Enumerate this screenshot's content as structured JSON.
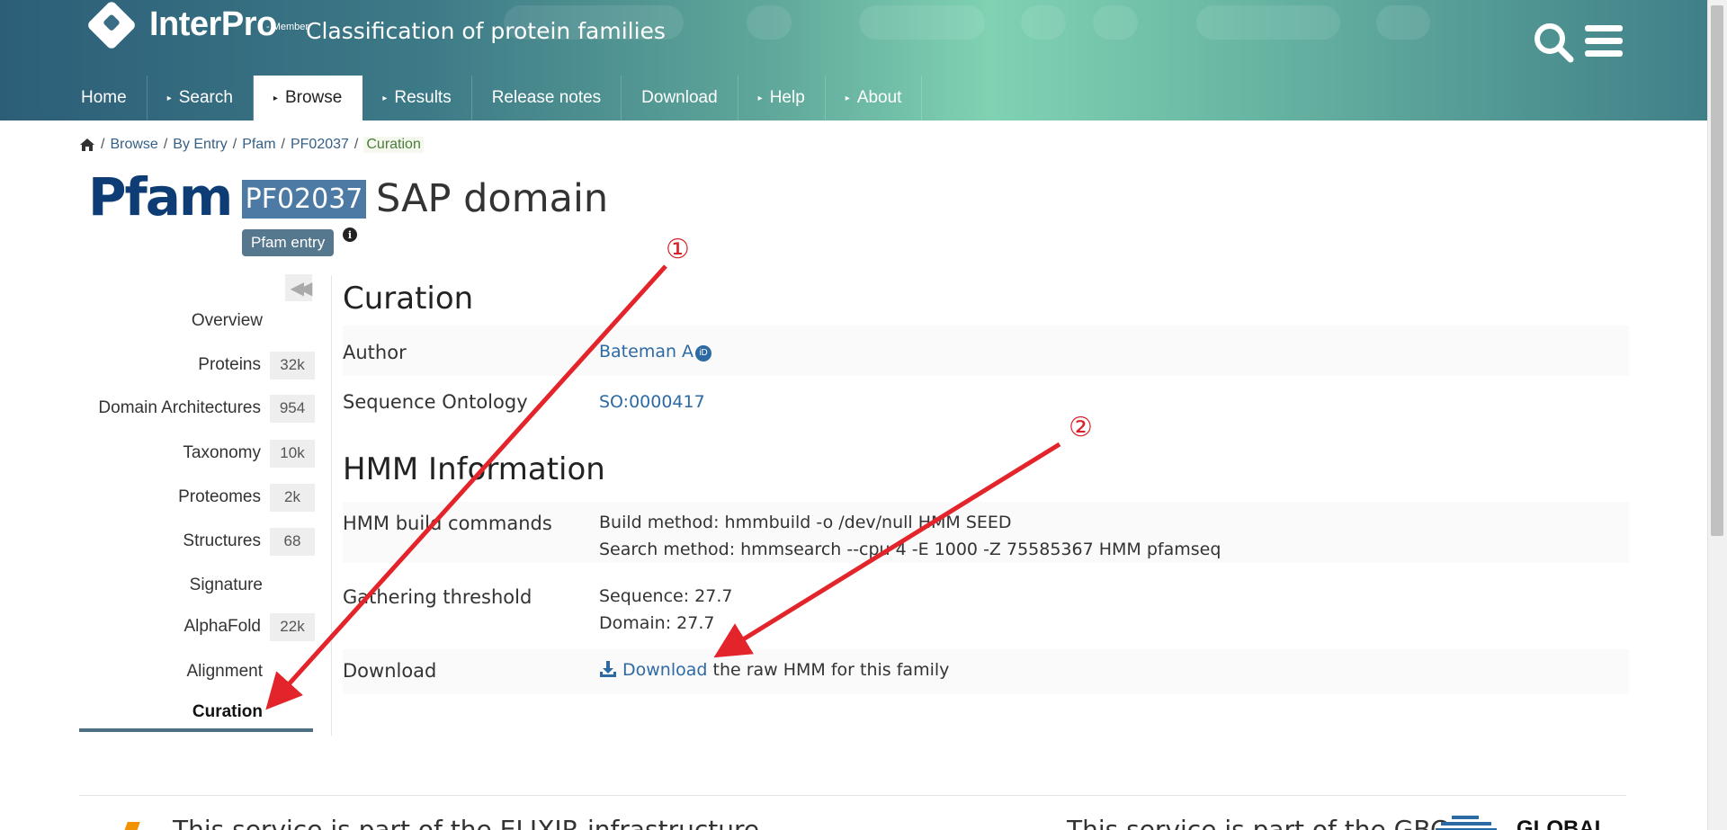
{
  "header": {
    "brand": "InterPro",
    "brand_sup": "- Member",
    "subtitle": "Classification of protein families",
    "icons": {
      "search": "search-icon",
      "menu": "hamburger-menu-icon",
      "logo": "interpro-logo"
    }
  },
  "nav": {
    "items": [
      {
        "label": "Home",
        "has_arrow": false
      },
      {
        "label": "Search",
        "has_arrow": true
      },
      {
        "label": "Browse",
        "has_arrow": true,
        "active": true
      },
      {
        "label": "Results",
        "has_arrow": true
      },
      {
        "label": "Release notes",
        "has_arrow": false
      },
      {
        "label": "Download",
        "has_arrow": false
      },
      {
        "label": "Help",
        "has_arrow": true
      },
      {
        "label": "About",
        "has_arrow": true
      }
    ],
    "arrow_glyph": "▸"
  },
  "breadcrumb": {
    "items": [
      "Browse",
      "By Entry",
      "Pfam",
      "PF02037"
    ],
    "current": "Curation",
    "separator": "/"
  },
  "entry": {
    "db_logo": "Pfam",
    "accession": "PF02037",
    "name": "SAP domain",
    "type_label": "Pfam entry",
    "info_glyph": "i"
  },
  "sidebar": {
    "collapse_glyph": "◀◀",
    "items": [
      {
        "label": "Overview",
        "count": ""
      },
      {
        "label": "Proteins",
        "count": "32k"
      },
      {
        "label": "Domain Architectures",
        "count": "954"
      },
      {
        "label": "Taxonomy",
        "count": "10k"
      },
      {
        "label": "Proteomes",
        "count": "2k"
      },
      {
        "label": "Structures",
        "count": "68"
      },
      {
        "label": "Signature",
        "count": ""
      },
      {
        "label": "AlphaFold",
        "count": "22k"
      },
      {
        "label": "Alignment",
        "count": ""
      },
      {
        "label": "Curation",
        "count": "",
        "active": true
      }
    ]
  },
  "curation": {
    "heading": "Curation",
    "author_label": "Author",
    "author_value": "Bateman A",
    "orcid_glyph": "iD",
    "so_label": "Sequence Ontology",
    "so_value": "SO:0000417"
  },
  "hmm": {
    "heading": "HMM Information",
    "build_label": "HMM build commands",
    "build_method": "Build method: hmmbuild -o /dev/null HMM SEED",
    "search_method": "Search method: hmmsearch --cpu 4 -E 1000 -Z 75585367 HMM pfamseq",
    "threshold_label": "Gathering threshold",
    "threshold_seq": "Sequence: 27.7",
    "threshold_dom": "Domain: 27.7",
    "download_label": "Download",
    "download_link": "Download",
    "download_rest": " the raw HMM for this family"
  },
  "annotations": {
    "marker1": "①",
    "marker2": "②",
    "arrow_color": "#e3242b"
  },
  "footer": {
    "elixir_text": "This service is part of the ELIXIR infrastructure",
    "gbc_text": "This service is part of the GBC",
    "gbc_word": "GLOBAL"
  },
  "colors": {
    "link": "#2d6aa3",
    "badge": "#4c7aa4",
    "type_badge": "#56788e",
    "pfam_logo": "#0e3c74"
  }
}
